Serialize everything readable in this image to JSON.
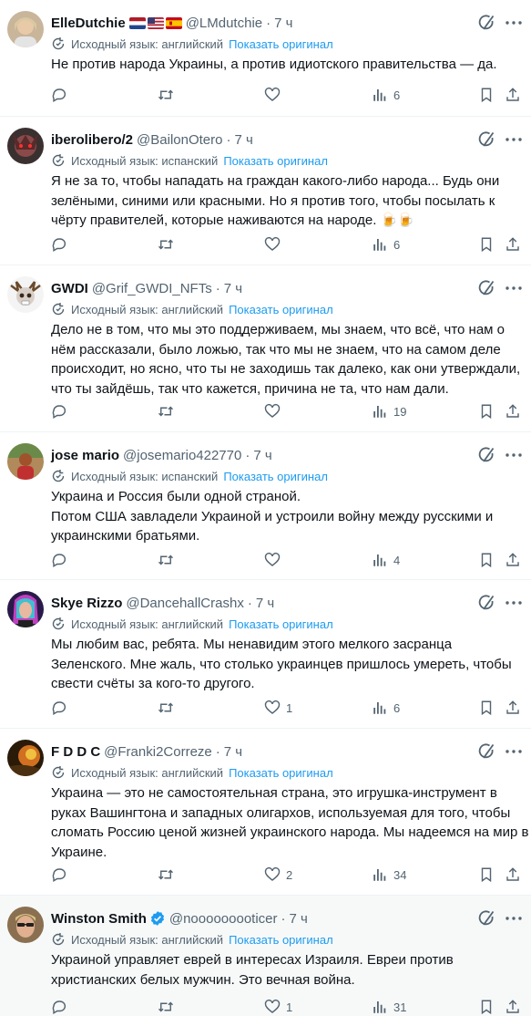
{
  "translation": {
    "lang_en": "Исходный язык: английский",
    "lang_es": "Исходный язык: испанский",
    "show_original": "Показать оригинал"
  },
  "colors": {
    "accent": "#1d9bf0",
    "muted": "#536471",
    "text": "#0f1419",
    "verified": "#1d9bf0"
  },
  "tweets": [
    {
      "name": "ElleDutchie",
      "flags": [
        "netherlands-flag",
        "usa-flag",
        "spain-flag"
      ],
      "handle": "@LMdutchie",
      "dot": "·",
      "time": "7 ч",
      "lines": [
        "Не против народа Украины, а против идиотского правительства — да."
      ],
      "views": "6"
    },
    {
      "name": "iberolibero/2",
      "handle": "@BailonOtero",
      "dot": "·",
      "time": "7 ч",
      "lines": [
        "Я не за то, чтобы нападать на граждан какого-либо народа... Будь они",
        "зелёными, синими или красными. Но я против того, чтобы посылать к",
        "чёрту правителей, которые наживаются на народе. 🍺🍺"
      ],
      "views": "6"
    },
    {
      "name": "GWDI",
      "handle": "@Grif_GWDI_NFTs",
      "dot": "·",
      "time": "7 ч",
      "lines": [
        "Дело не в том, что мы это поддерживаем, мы знаем, что всё, что нам о",
        "нём рассказали, было ложью, так что мы не знаем, что на самом деле",
        "происходит, но ясно, что ты не заходишь так далеко, как они утверждали,",
        "что ты зайдёшь, так что кажется, причина не та, что нам дали."
      ],
      "views": "19"
    },
    {
      "name": "jose mario",
      "handle": "@josemario422770",
      "dot": "·",
      "time": "7 ч",
      "lines": [
        "Украина и Россия были одной страной.",
        "Потом США завладели Украиной и устроили войну между русскими и",
        "украинскими братьями."
      ],
      "views": "4"
    },
    {
      "name": "Skye Rizzo",
      "handle": "@DancehallCrashx",
      "dot": "·",
      "time": "7 ч",
      "lines": [
        "Мы любим вас, ребята. Мы ненавидим этого мелкого засранца",
        "Зеленского. Мне жаль, что столько украинцев пришлось умереть, чтобы",
        "свести счёты за кого-то другого."
      ],
      "likes": "1",
      "views": "6"
    },
    {
      "name": "F D D C",
      "handle": "@Franki2Correze",
      "dot": "·",
      "time": "7 ч",
      "lines": [
        "Украина — это не самостоятельная страна, это игрушка-инструмент в",
        "руках Вашингтона и западных олигархов, используемая для того, чтобы",
        "сломать Россию ценой жизней украинского народа. Мы надеемся на мир в",
        "Украине."
      ],
      "likes": "2",
      "views": "34"
    },
    {
      "name": "Winston Smith",
      "handle": "@nooooooooticer",
      "dot": "·",
      "time": "7 ч",
      "lines": [
        "Украиной управляет еврей в интересах Израиля. Евреи против",
        "христианских белых мужчин. Это вечная война."
      ],
      "likes": "1",
      "views": "31"
    }
  ]
}
